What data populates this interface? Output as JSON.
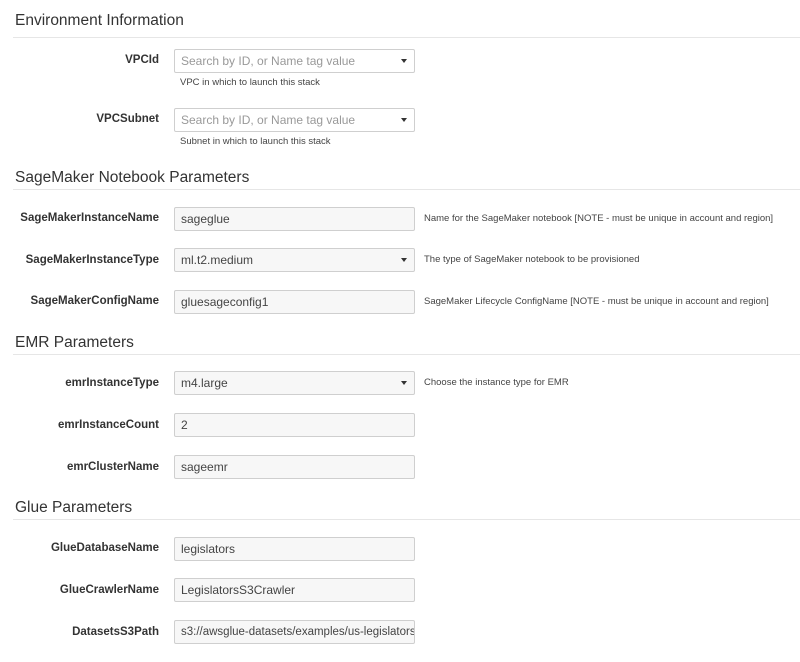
{
  "sections": {
    "environment": {
      "title": "Environment Information",
      "vpcid": {
        "label": "VPCId",
        "placeholder": "Search by ID, or Name tag value",
        "help": "VPC in which to launch this stack"
      },
      "vpcsubnet": {
        "label": "VPCSubnet",
        "placeholder": "Search by ID, or Name tag value",
        "help": "Subnet in which to launch this stack"
      }
    },
    "sagemaker": {
      "title": "SageMaker Notebook Parameters",
      "instance_name": {
        "label": "SageMakerInstanceName",
        "value": "sageglue",
        "help": "Name for the SageMaker notebook [NOTE - must be unique in account and region]"
      },
      "instance_type": {
        "label": "SageMakerInstanceType",
        "value": "ml.t2.medium",
        "help": "The type of SageMaker notebook to be provisioned"
      },
      "config_name": {
        "label": "SageMakerConfigName",
        "value": "gluesageconfig1",
        "help": "SageMaker Lifecycle ConfigName [NOTE - must be unique in account and region]"
      }
    },
    "emr": {
      "title": "EMR Parameters",
      "instance_type": {
        "label": "emrInstanceType",
        "value": "m4.large",
        "help": "Choose the instance type for EMR"
      },
      "instance_count": {
        "label": "emrInstanceCount",
        "value": "2"
      },
      "cluster_name": {
        "label": "emrClusterName",
        "value": "sageemr"
      }
    },
    "glue": {
      "title": "Glue Parameters",
      "database_name": {
        "label": "GlueDatabaseName",
        "value": "legislators"
      },
      "crawler_name": {
        "label": "GlueCrawlerName",
        "value": "LegislatorsS3Crawler"
      },
      "datasets_path": {
        "label": "DatasetsS3Path",
        "value": "s3://awsglue-datasets/examples/us-legislators"
      }
    }
  },
  "icons": {
    "dropdown": "chevron-down-icon"
  },
  "colors": {
    "text": "#333333",
    "border": "#cfcfcf",
    "field_bg": "#f7f7f7",
    "rule": "#e6e6e6"
  }
}
